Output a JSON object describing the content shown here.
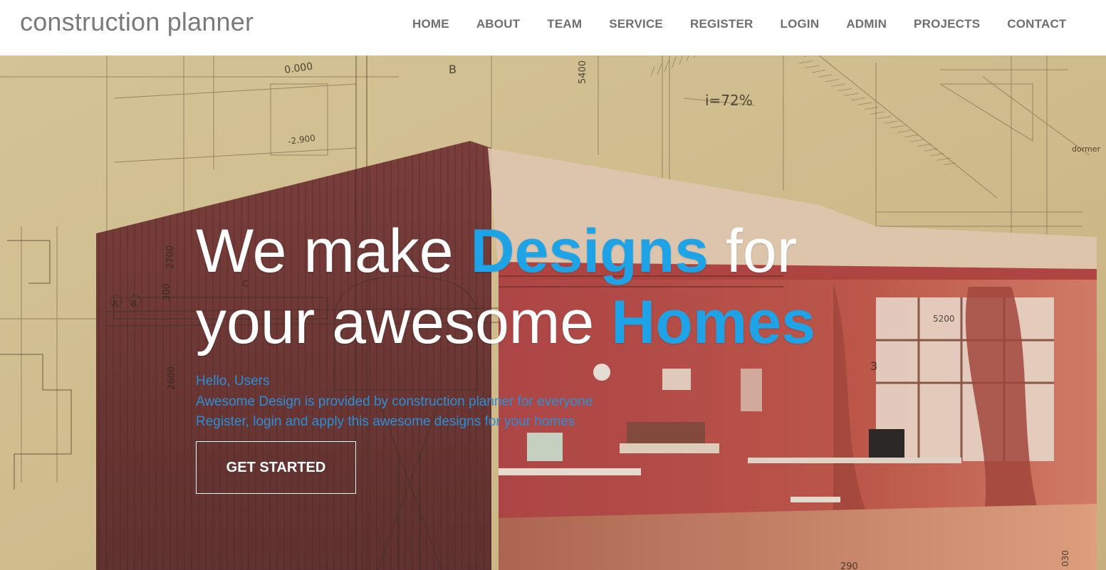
{
  "header": {
    "brand": "construction planner",
    "nav": [
      "HOME",
      "ABOUT",
      "TEAM",
      "SERVICE",
      "REGISTER",
      "LOGIN",
      "ADMIN",
      "PROJECTS",
      "CONTACT"
    ]
  },
  "hero": {
    "title_part1": "We make ",
    "title_highlight1": "Designs",
    "title_part2": " for",
    "title_part3": "your awesome ",
    "title_highlight2": "Homes",
    "line1": "Hello, Users",
    "line2": "Awesome Design is provided by construction planner for everyone",
    "line3": "Register, login and apply this awesome designs for your homes",
    "cta_label": "GET STARTED",
    "blueprint_text": [
      "0.000",
      "B",
      "i=72%",
      "5400",
      "dormer",
      "-2.900",
      "2700",
      "300",
      "2600",
      "A",
      "B",
      "C",
      "3",
      "5200",
      "030",
      "290"
    ]
  },
  "colors": {
    "accent": "#1ea3e6",
    "hero_text": "#2a8fd6",
    "nav_text": "#6f6f6f",
    "brand_text": "#7a7a7a"
  }
}
